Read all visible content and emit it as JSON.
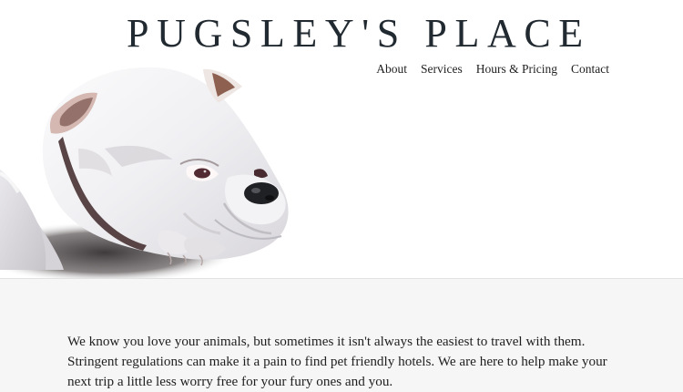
{
  "site": {
    "title": "PUGSLEY'S PLACE"
  },
  "nav": {
    "items": [
      {
        "label": "About"
      },
      {
        "label": "Services"
      },
      {
        "label": "Hours & Pricing"
      },
      {
        "label": "Contact"
      }
    ]
  },
  "hero": {
    "image": "bulldog-photo"
  },
  "main": {
    "intro_lines": [
      "We know you love your animals, but sometimes it isn't always the easiest to travel with them.",
      "Stringent regulations can make it a pain to find pet friendly hotels. We are here to help make your",
      "next trip a little less worry free for your fury ones and you."
    ]
  },
  "colors": {
    "title": "#222a31",
    "text": "#1f1f1f",
    "content_background": "#f6f6f7"
  }
}
